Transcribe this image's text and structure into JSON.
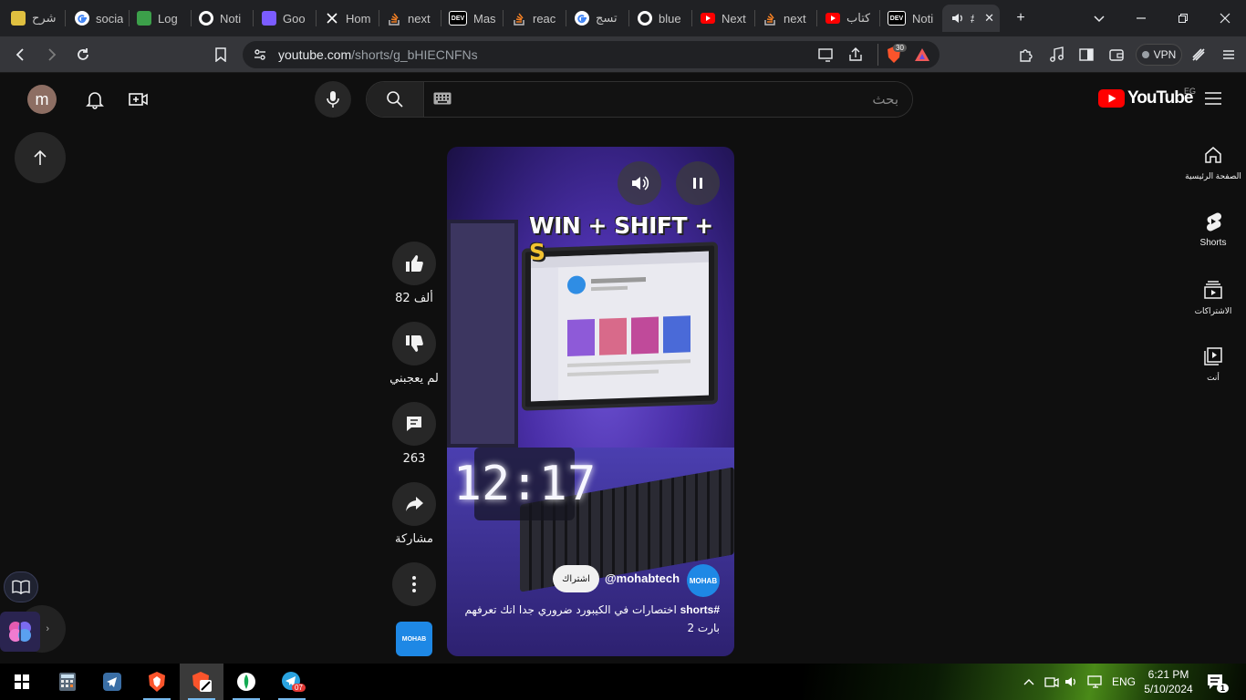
{
  "browser": {
    "tabs": [
      {
        "title": "شرح",
        "favicon": "globe-icon",
        "color": "#e0c040"
      },
      {
        "title": "socia",
        "favicon": "google-icon",
        "color": "#4285f4"
      },
      {
        "title": "Log",
        "favicon": "leaf-icon",
        "color": "#3ca04a"
      },
      {
        "title": "Noti",
        "favicon": "github-icon",
        "color": "#ffffff"
      },
      {
        "title": "Goo",
        "favicon": "shield-icon",
        "color": "#7b5cff"
      },
      {
        "title": "Hom",
        "favicon": "x-icon",
        "color": "#ffffff"
      },
      {
        "title": "next",
        "favicon": "stackoverflow-icon",
        "color": "#f48024"
      },
      {
        "title": "Mas",
        "favicon": "dev-icon",
        "color": "#000000"
      },
      {
        "title": "reac",
        "favicon": "stackoverflow-icon",
        "color": "#f48024"
      },
      {
        "title": "تسج",
        "favicon": "google-icon",
        "color": "#4285f4"
      },
      {
        "title": "blue",
        "favicon": "github-icon",
        "color": "#ffffff"
      },
      {
        "title": "Next",
        "favicon": "youtube-icon",
        "color": "#ff0000"
      },
      {
        "title": "next",
        "favicon": "stackoverflow-icon",
        "color": "#f48024"
      },
      {
        "title": "كتاب",
        "favicon": "youtube-icon",
        "color": "#ff0000"
      },
      {
        "title": "Noti",
        "favicon": "dev-icon",
        "color": "#000000"
      },
      {
        "title": "#",
        "favicon": "speaker-icon",
        "color": "#e8eaed",
        "active": true
      }
    ],
    "dev_badge": "DEV",
    "new_tab": "+",
    "url_host": "youtube.com",
    "url_path": "/shorts/g_bHIECNFNs",
    "brave_count": "30",
    "vpn_label": "VPN"
  },
  "youtube": {
    "avatar_letter": "m",
    "search_placeholder": "بحث",
    "logo_text": "YouTube",
    "country_code": "EG",
    "nav": [
      {
        "label": "الصفحة الرئيسية",
        "icon": "home-icon"
      },
      {
        "label": "Shorts",
        "icon": "shorts-icon"
      },
      {
        "label": "الاشتراكات",
        "icon": "subscriptions-icon"
      },
      {
        "label": "أنت",
        "icon": "you-icon"
      }
    ],
    "short": {
      "overlay_text_main": "WIN + SHIFT + ",
      "overlay_text_key": "S",
      "clock_display": "12:17",
      "subscribe_label": "اشتراك",
      "channel_handle": "@mohabtech",
      "channel_avatar_text": "MOHAB",
      "caption_tag": "#shorts",
      "caption_text": " اختصارات في الكيبورد ضروري جدا انك تعرفهم بارت 2"
    },
    "actions": {
      "like_count": "82 ألف",
      "dislike_label": "لم يعجبني",
      "comment_count": "263",
      "share_label": "مشاركة",
      "remix_text": "MOHAB"
    }
  },
  "taskbar": {
    "apps": [
      "start-icon",
      "calculator-icon",
      "telegram-desktop-icon",
      "brave-icon",
      "brave-beta-icon",
      "mongodb-icon",
      "telegram-icon"
    ],
    "telegram_badge": "07",
    "lang": "ENG",
    "time": "6:21 PM",
    "date": "5/10/2024",
    "notification_count": "1"
  }
}
